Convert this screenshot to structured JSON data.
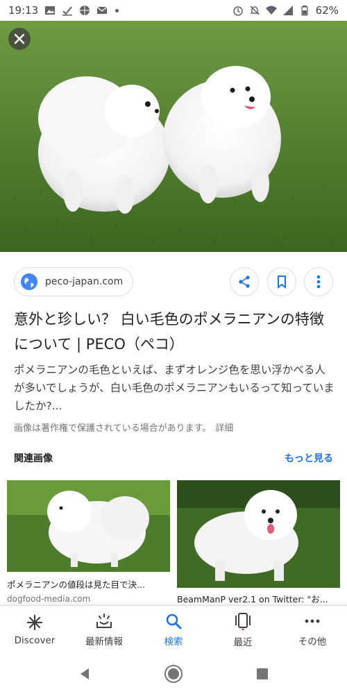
{
  "status_bar": {
    "time": "19:13",
    "battery": "62%"
  },
  "hero": {
    "alt": "白いポメラニアン"
  },
  "source": {
    "domain": "peco-japan.com"
  },
  "result": {
    "title": "意外と珍しい？ 白い毛色のポメラニアンの特徴について | PECO（ペコ）",
    "description": "ポメラニアンの毛色といえば、まずオレンジ色を思い浮かべる人が多いでしょうが、白い毛色のポメラニアンもいるって知っていましたか?...",
    "copyright_notice": "画像は著作権で保護されている場合があります。",
    "detail_link": "詳細"
  },
  "related": {
    "header": "関連画像",
    "more_link": "もっと見る",
    "cards": [
      {
        "caption": "ポメラニアンの値段は見た目で決...",
        "source": "dogfood-media.com"
      },
      {
        "caption": "BeamManP ver2.1 on Twitter: \"お...",
        "source": ""
      }
    ]
  },
  "bottom_nav": [
    {
      "label": "Discover",
      "icon": "asterisk-icon"
    },
    {
      "label": "最新情報",
      "icon": "updates-icon"
    },
    {
      "label": "検索",
      "icon": "search-icon",
      "active": true
    },
    {
      "label": "最近",
      "icon": "recent-icon"
    },
    {
      "label": "その他",
      "icon": "more-dots-icon"
    }
  ],
  "colors": {
    "accent": "#1a73e8",
    "grass": "#4f7c2a"
  }
}
